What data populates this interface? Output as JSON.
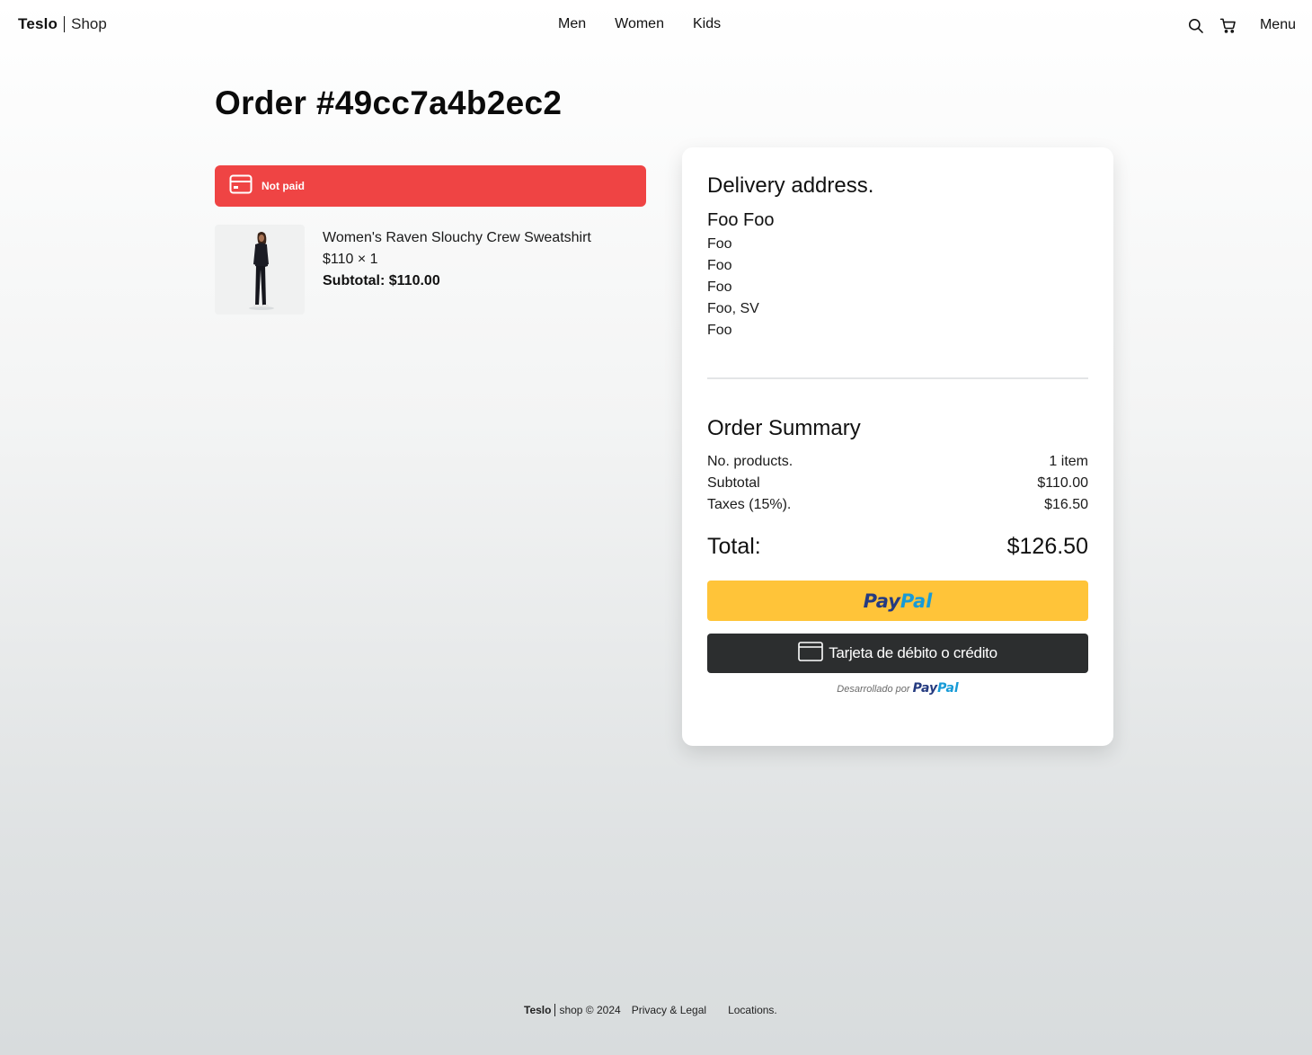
{
  "header": {
    "brand_main": "Teslo",
    "brand_sub": "Shop",
    "nav": [
      {
        "label": "Men"
      },
      {
        "label": "Women"
      },
      {
        "label": "Kids"
      }
    ],
    "icons": [
      "search-icon",
      "cart-icon"
    ],
    "menu_label": "Menu"
  },
  "order": {
    "title": "Order #49cc7a4b2ec2",
    "status_label": "Not paid",
    "status_color": "#ef4444",
    "items": [
      {
        "name": "Women's Raven Slouchy Crew Sweatshirt",
        "price_qty": "$110 × 1",
        "subtotal": "Subtotal: $110.00"
      }
    ]
  },
  "delivery": {
    "title": "Delivery address.",
    "name": "Foo Foo",
    "lines": [
      "Foo",
      "Foo",
      "Foo",
      "Foo, SV",
      "Foo"
    ]
  },
  "summary": {
    "title": "Order Summary",
    "rows": [
      {
        "label": "No. products.",
        "value": "1 item"
      },
      {
        "label": "Subtotal",
        "value": "$110.00"
      },
      {
        "label": "Taxes (15%).",
        "value": "$16.50"
      }
    ],
    "total_label": "Total:",
    "total_value": "$126.50"
  },
  "payment": {
    "paypal_part1": "Pay",
    "paypal_part2": "Pal",
    "card_button_label": "Tarjeta de débito o crédito",
    "powered_by": "Desarrollado por",
    "powered_logo_part1": "Pay",
    "powered_logo_part2": "Pal",
    "paypal_yellow": "#ffc439",
    "card_button_color": "#2c2e2f"
  },
  "footer": {
    "brand_main": "Teslo",
    "brand_sub": "shop © 2024",
    "links": [
      {
        "label": "Privacy & Legal"
      },
      {
        "label": "Locations."
      }
    ]
  }
}
